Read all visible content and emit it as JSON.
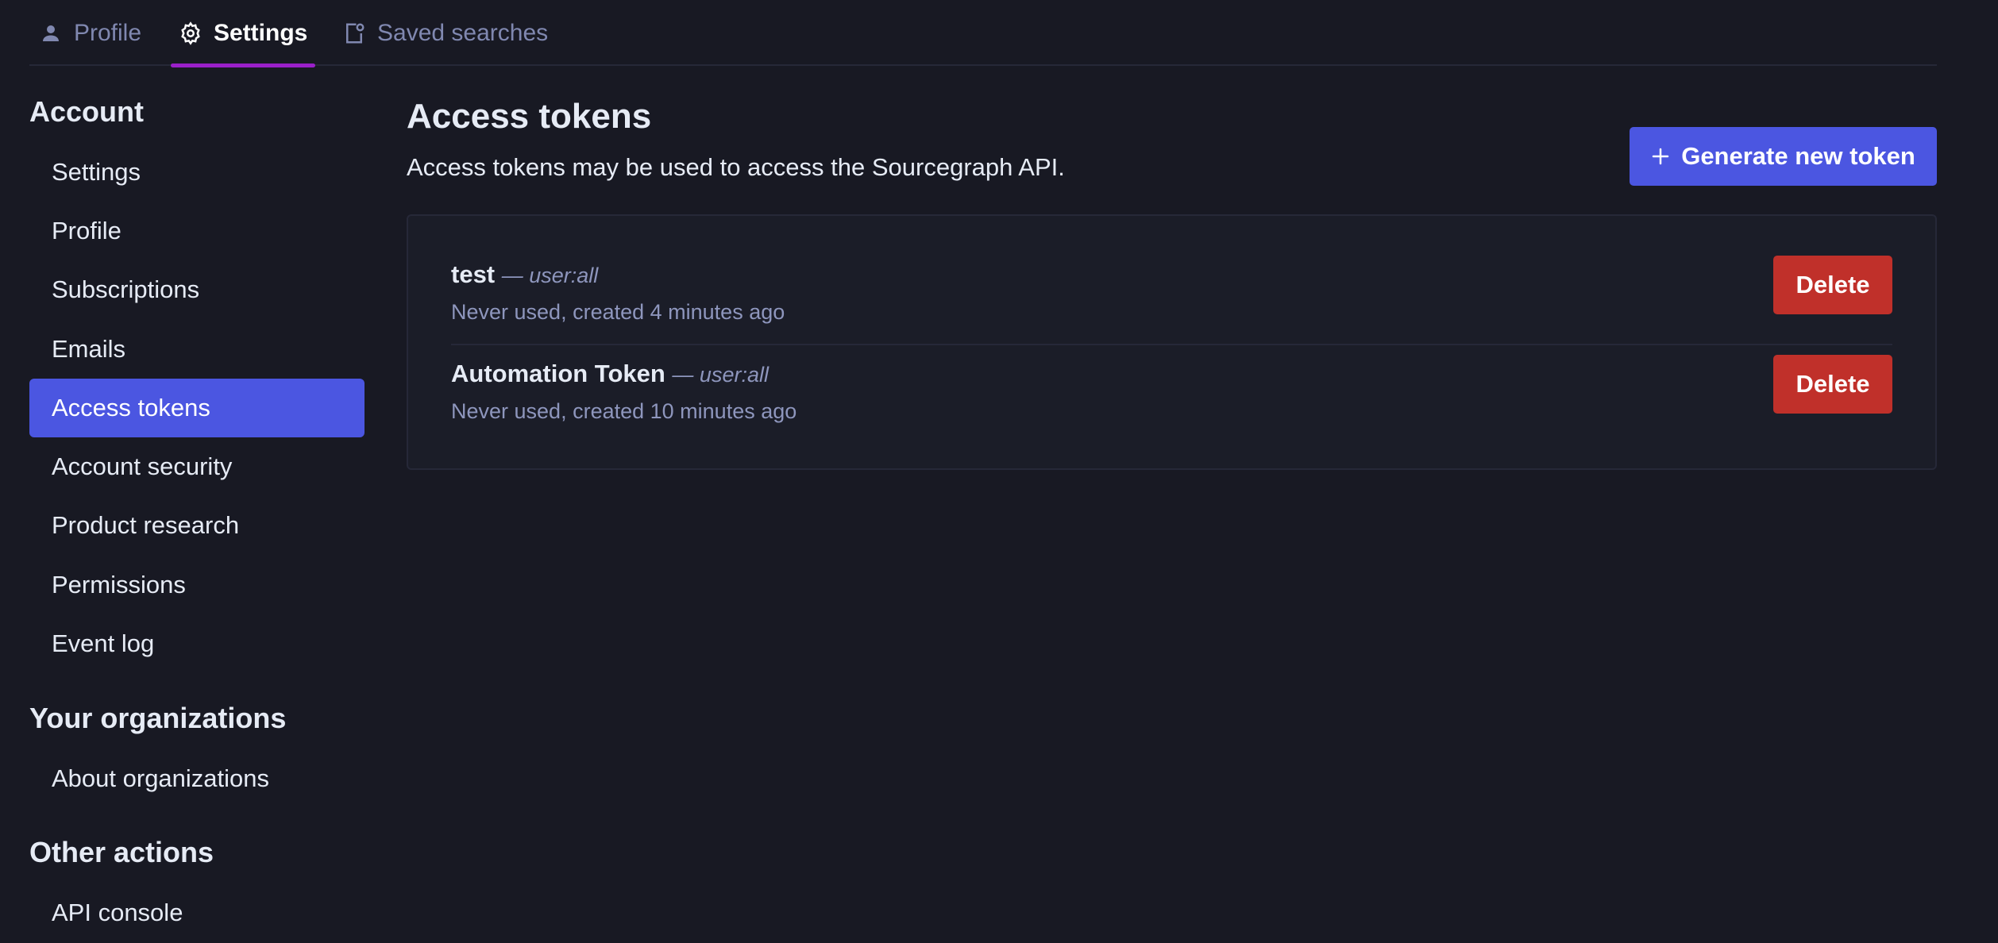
{
  "tabs": [
    {
      "label": "Profile",
      "icon": "user-icon"
    },
    {
      "label": "Settings",
      "icon": "gear-icon",
      "active": true
    },
    {
      "label": "Saved searches",
      "icon": "saved-search-icon"
    }
  ],
  "sidebar": {
    "account_title": "Account",
    "account_items": [
      {
        "label": "Settings"
      },
      {
        "label": "Profile"
      },
      {
        "label": "Subscriptions"
      },
      {
        "label": "Emails"
      },
      {
        "label": "Access tokens",
        "active": true
      },
      {
        "label": "Account security"
      },
      {
        "label": "Product research"
      },
      {
        "label": "Permissions"
      },
      {
        "label": "Event log"
      }
    ],
    "orgs_title": "Your organizations",
    "orgs_items": [
      {
        "label": "About organizations"
      }
    ],
    "other_title": "Other actions",
    "other_items": [
      {
        "label": "API console"
      }
    ]
  },
  "main": {
    "title": "Access tokens",
    "description": "Access tokens may be used to access the Sourcegraph API.",
    "generate_label": "Generate new token",
    "tokens": [
      {
        "name": "test",
        "scope": "— user:all",
        "meta": "Never used, created 4 minutes ago",
        "delete_label": "Delete"
      },
      {
        "name": "Automation Token",
        "scope": "— user:all",
        "meta": "Never used, created 10 minutes ago",
        "delete_label": "Delete"
      }
    ]
  },
  "colors": {
    "background": "#181923",
    "accent": "#4b56e1",
    "danger": "#c0302a",
    "tab_indicator": "#9a20c9"
  }
}
